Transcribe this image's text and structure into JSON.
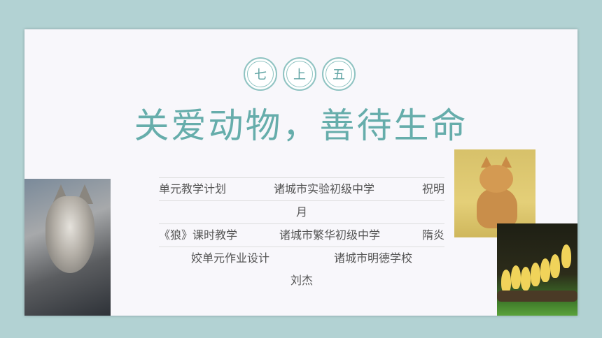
{
  "badges": [
    "七",
    "上",
    "五"
  ],
  "title": "关爱动物，善待生命",
  "rows": [
    {
      "a": "单元教学计划",
      "b": "诸城市实验初级中学",
      "c": "祝明"
    },
    {
      "a": "月"
    },
    {
      "a": "《狼》课时教学",
      "b": "诸城市繁华初级中学",
      "c": "隋炎"
    },
    {
      "a": "姣单元作业设计",
      "b": "诸城市明德学校"
    },
    {
      "a": "刘杰"
    }
  ],
  "colors": {
    "accent": "#66adab",
    "frame": "#b2d2d3"
  }
}
